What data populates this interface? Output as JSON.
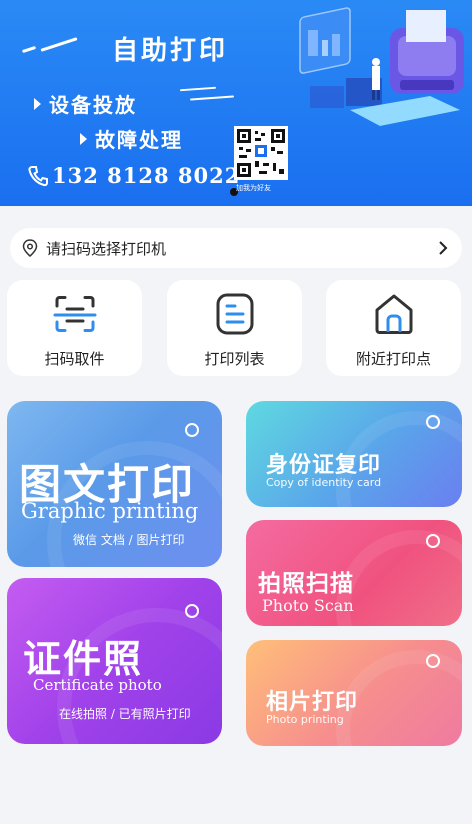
{
  "banner": {
    "title": "自助打印",
    "line1": "设备投放",
    "line2": "故障处理",
    "phone": "132 8128 8022",
    "qr_caption": "加我为好友"
  },
  "location": {
    "label": "请扫码选择打印机",
    "icon": "location-pin-icon",
    "chevron": "chevron-right-icon"
  },
  "quick_actions": [
    {
      "label": "扫码取件",
      "icon": "scan-icon"
    },
    {
      "label": "打印列表",
      "icon": "list-doc-icon"
    },
    {
      "label": "附近打印点",
      "icon": "home-icon"
    }
  ],
  "cards": {
    "graphic": {
      "cn": "图文打印",
      "en": "Graphic printing",
      "sub": "微信 文档 / 图片打印"
    },
    "cert": {
      "cn": "证件照",
      "en": "Certificate photo",
      "sub": "在线拍照 / 已有照片打印"
    },
    "idcard": {
      "cn": "身份证复印",
      "en": "Copy of identity card"
    },
    "scan": {
      "cn": "拍照扫描",
      "en": "Photo Scan"
    },
    "photo": {
      "cn": "相片打印",
      "en": "Photo printing"
    }
  },
  "colors": {
    "banner": "#1a6ff0",
    "accent_blue": "#2e8ef0"
  }
}
